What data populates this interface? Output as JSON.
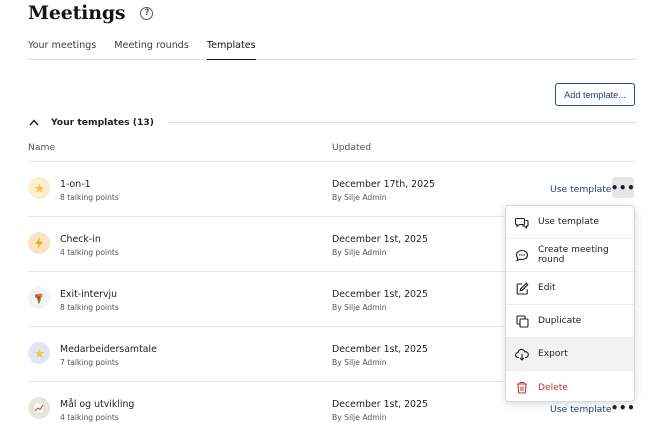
{
  "header": {
    "title": "Meetings",
    "help_icon": "question-circle-icon"
  },
  "tabs": [
    {
      "label": "Your meetings",
      "active": false
    },
    {
      "label": "Meeting rounds",
      "active": false
    },
    {
      "label": "Templates",
      "active": true
    }
  ],
  "toolbar": {
    "add_template_label": "Add template..."
  },
  "section": {
    "title": "Your templates (13)",
    "icon": "chevron-up-icon"
  },
  "columns": {
    "name": "Name",
    "updated": "Updated"
  },
  "templates": [
    {
      "name": "1-on-1",
      "points": "8 talking points",
      "date": "December 17th, 2025",
      "by": "By Silje Admin",
      "icon": "star-icon",
      "icon_bg": "#fbefcf",
      "use_label": "Use template"
    },
    {
      "name": "Check-in",
      "points": "4 talking points",
      "date": "December 1st, 2025",
      "by": "By Silje Admin",
      "icon": "lightning-icon",
      "icon_bg": "#fbe4c2"
    },
    {
      "name": "Exit-intervju",
      "points": "8 talking points",
      "date": "December 1st, 2025",
      "by": "By Silje Admin",
      "icon": "bouquet-icon",
      "icon_bg": "#f3f3f3"
    },
    {
      "name": "Medarbeidersamtale",
      "points": "7 talking points",
      "date": "December 1st, 2025",
      "by": "By Silje Admin",
      "icon": "star-icon",
      "icon_bg": "#dfe7f7"
    },
    {
      "name": "Mål og utvikling",
      "points": "4 talking points",
      "date": "December 1st, 2025",
      "by": "By Silje Admin",
      "icon": "chart-icon",
      "icon_bg": "#e3eadb",
      "use_label": "Use template"
    }
  ],
  "context_menu": {
    "items": [
      {
        "label": "Use template",
        "icon": "chat-bubbles-icon"
      },
      {
        "label": "Create meeting round",
        "icon": "chat-bubble-dots-icon"
      },
      {
        "label": "Edit",
        "icon": "edit-icon"
      },
      {
        "label": "Duplicate",
        "icon": "duplicate-icon"
      },
      {
        "label": "Export",
        "icon": "cloud-download-icon"
      },
      {
        "label": "Delete",
        "icon": "trash-icon"
      }
    ]
  },
  "colors": {
    "accent": "#24407a",
    "danger": "#c0392b",
    "menu_hover": "#f2f2f2"
  }
}
